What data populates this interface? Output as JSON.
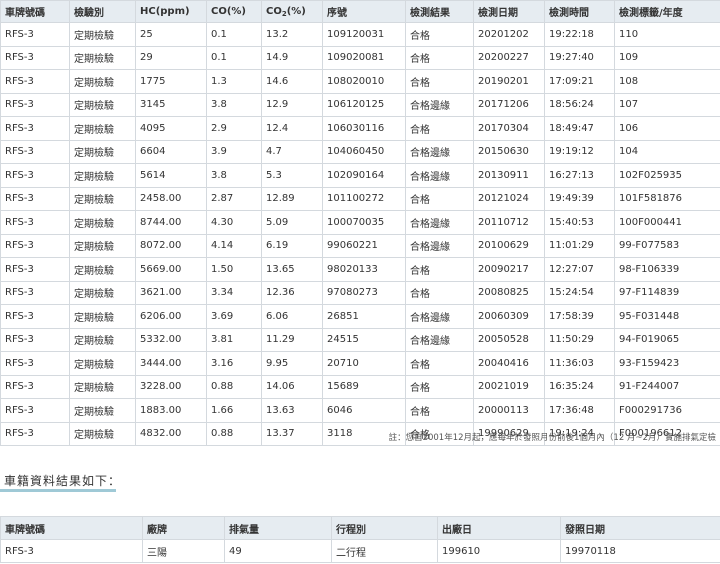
{
  "inspection": {
    "headers": {
      "plate": "車牌號碼",
      "category": "檢驗別",
      "hc": "HC(ppm)",
      "co": "CO(%)",
      "co2_prefix": "CO",
      "co2_sub": "2",
      "co2_suffix": "(%)",
      "serial": "序號",
      "result": "檢測結果",
      "date": "檢測日期",
      "time": "檢測時間",
      "label": "檢測標籤/年度"
    },
    "rows": [
      {
        "plate": "RFS-3",
        "category": "定期檢驗",
        "hc": "25",
        "co": "0.1",
        "co2": "13.2",
        "serial": "109120031",
        "result": "合格",
        "date": "20201202",
        "time": "19:22:18",
        "label": "110"
      },
      {
        "plate": "RFS-3",
        "category": "定期檢驗",
        "hc": "29",
        "co": "0.1",
        "co2": "14.9",
        "serial": "109020081",
        "result": "合格",
        "date": "20200227",
        "time": "19:27:40",
        "label": "109"
      },
      {
        "plate": "RFS-3",
        "category": "定期檢驗",
        "hc": "1775",
        "co": "1.3",
        "co2": "14.6",
        "serial": "108020010",
        "result": "合格",
        "date": "20190201",
        "time": "17:09:21",
        "label": "108"
      },
      {
        "plate": "RFS-3",
        "category": "定期檢驗",
        "hc": "3145",
        "co": "3.8",
        "co2": "12.9",
        "serial": "106120125",
        "result": "合格邊緣",
        "date": "20171206",
        "time": "18:56:24",
        "label": "107"
      },
      {
        "plate": "RFS-3",
        "category": "定期檢驗",
        "hc": "4095",
        "co": "2.9",
        "co2": "12.4",
        "serial": "106030116",
        "result": "合格",
        "date": "20170304",
        "time": "18:49:47",
        "label": "106"
      },
      {
        "plate": "RFS-3",
        "category": "定期檢驗",
        "hc": "6604",
        "co": "3.9",
        "co2": "4.7",
        "serial": "104060450",
        "result": "合格邊緣",
        "date": "20150630",
        "time": "19:19:12",
        "label": "104"
      },
      {
        "plate": "RFS-3",
        "category": "定期檢驗",
        "hc": "5614",
        "co": "3.8",
        "co2": "5.3",
        "serial": "102090164",
        "result": "合格邊緣",
        "date": "20130911",
        "time": "16:27:13",
        "label": "102F025935"
      },
      {
        "plate": "RFS-3",
        "category": "定期檢驗",
        "hc": "2458.00",
        "co": "2.87",
        "co2": "12.89",
        "serial": "101100272",
        "result": "合格",
        "date": "20121024",
        "time": "19:49:39",
        "label": "101F581876"
      },
      {
        "plate": "RFS-3",
        "category": "定期檢驗",
        "hc": "8744.00",
        "co": "4.30",
        "co2": "5.09",
        "serial": "100070035",
        "result": "合格邊緣",
        "date": "20110712",
        "time": "15:40:53",
        "label": "100F000441"
      },
      {
        "plate": "RFS-3",
        "category": "定期檢驗",
        "hc": "8072.00",
        "co": "4.14",
        "co2": "6.19",
        "serial": "99060221",
        "result": "合格邊緣",
        "date": "20100629",
        "time": "11:01:29",
        "label": "99-F077583"
      },
      {
        "plate": "RFS-3",
        "category": "定期檢驗",
        "hc": "5669.00",
        "co": "1.50",
        "co2": "13.65",
        "serial": "98020133",
        "result": "合格",
        "date": "20090217",
        "time": "12:27:07",
        "label": "98-F106339"
      },
      {
        "plate": "RFS-3",
        "category": "定期檢驗",
        "hc": "3621.00",
        "co": "3.34",
        "co2": "12.36",
        "serial": "97080273",
        "result": "合格",
        "date": "20080825",
        "time": "15:24:54",
        "label": "97-F114839"
      },
      {
        "plate": "RFS-3",
        "category": "定期檢驗",
        "hc": "6206.00",
        "co": "3.69",
        "co2": "6.06",
        "serial": "26851",
        "result": "合格邊緣",
        "date": "20060309",
        "time": "17:58:39",
        "label": "95-F031448"
      },
      {
        "plate": "RFS-3",
        "category": "定期檢驗",
        "hc": "5332.00",
        "co": "3.81",
        "co2": "11.29",
        "serial": "24515",
        "result": "合格邊緣",
        "date": "20050528",
        "time": "11:50:29",
        "label": "94-F019065"
      },
      {
        "plate": "RFS-3",
        "category": "定期檢驗",
        "hc": "3444.00",
        "co": "3.16",
        "co2": "9.95",
        "serial": "20710",
        "result": "合格",
        "date": "20040416",
        "time": "11:36:03",
        "label": "93-F159423"
      },
      {
        "plate": "RFS-3",
        "category": "定期檢驗",
        "hc": "3228.00",
        "co": "0.88",
        "co2": "14.06",
        "serial": "15689",
        "result": "合格",
        "date": "20021019",
        "time": "16:35:24",
        "label": "91-F244007"
      },
      {
        "plate": "RFS-3",
        "category": "定期檢驗",
        "hc": "1883.00",
        "co": "1.66",
        "co2": "13.63",
        "serial": "6046",
        "result": "合格",
        "date": "20000113",
        "time": "17:36:48",
        "label": "F000291736"
      },
      {
        "plate": "RFS-3",
        "category": "定期檢驗",
        "hc": "4832.00",
        "co": "0.88",
        "co2": "13.37",
        "serial": "3118",
        "result": "合格",
        "date": "19990629",
        "time": "19:19:24",
        "label": "F000196612"
      }
    ],
    "note": "註：您自2001年12月起，應每年於發照月份前後1個月內（12 月~2月）實施排氣定檢"
  },
  "vehicle": {
    "section_title": "車籍資料結果如下：",
    "headers": {
      "plate": "車牌號碼",
      "brand": "廠牌",
      "displacement": "排氣量",
      "stroke": "行程別",
      "manufactured": "出廠日",
      "issued": "發照日期"
    },
    "row": {
      "plate": "RFS-3",
      "brand": "三陽",
      "displacement": "49",
      "stroke": "二行程",
      "manufactured": "199610",
      "issued": "19970118"
    }
  },
  "colors": {
    "header_bg": "#e6ecf1",
    "border": "#d4d9de",
    "accent_underline": "#9fc9d6"
  }
}
